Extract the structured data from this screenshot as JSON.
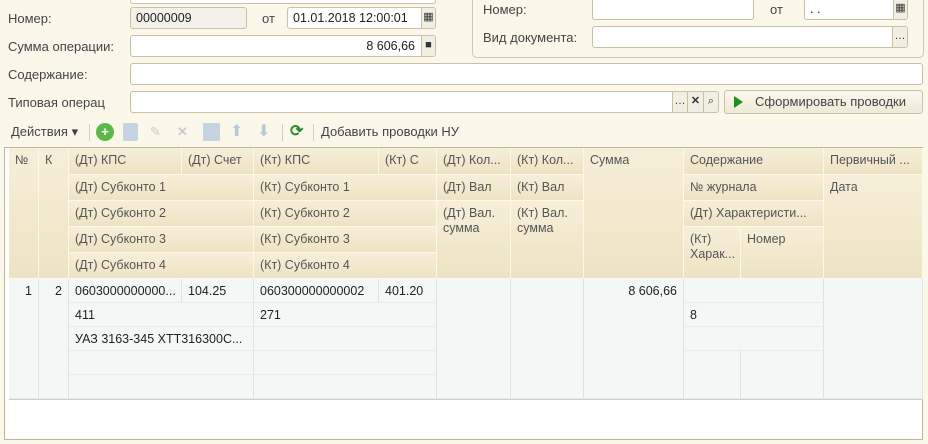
{
  "form": {
    "number_label": "Номер:",
    "number_value": "00000009",
    "from_label": "от",
    "date_value": "01.01.2018 12:00:01",
    "sum_label": "Сумма операции:",
    "sum_value": "8 606,66",
    "content_label": "Содержание:",
    "content_value": "",
    "typical_label": "Типовая операц",
    "typical_value": "",
    "generate_button": "Сформировать проводки"
  },
  "incoming": {
    "number_label": "Номер:",
    "number_value": "",
    "from_label": "от",
    "date_value": " .  . ",
    "doctype_label": "Вид документа:",
    "doctype_value": ""
  },
  "toolbar": {
    "actions": "Действия ▾",
    "add_nu": "Добавить проводки НУ"
  },
  "table": {
    "headers": {
      "n": "№",
      "k": "К",
      "dt_kps": "(Дт) КПС",
      "dt_acc": "(Дт) Счет",
      "kt_kps": "(Кт) КПС",
      "kt_acc": "(Кт) С",
      "dt_qty": "(Дт) Кол...",
      "kt_qty": "(Кт) Кол...",
      "sum": "Сумма",
      "content": "Содержание",
      "primary": "Первичный ...",
      "dt_sub1": "(Дт) Субконто 1",
      "kt_sub1": "(Кт) Субконто 1",
      "dt_cur": "(Дт) Вал",
      "kt_cur": "(Кт) Вал",
      "journal": "№ журнала",
      "date": "Дата",
      "dt_sub2": "(Дт) Субконто 2",
      "kt_sub2": "(Кт) Субконто 2",
      "dt_cur_sum": "(Дт) Вал. сумма",
      "kt_cur_sum": "(Кт) Вал. сумма",
      "dt_char": "(Дт) Характеристи...",
      "dt_sub3": "(Дт) Субконто 3",
      "kt_sub3": "(Кт) Субконто 3",
      "kt_char": "(Кт) Харак...",
      "number": "Номер",
      "dt_sub4": "(Дт) Субконто 4",
      "kt_sub4": "(Кт) Субконто 4"
    },
    "rows": [
      {
        "n": "1",
        "k": "2",
        "dt_kps": "0603000000000...",
        "dt_acc": "104.25",
        "kt_kps": "060300000000002",
        "kt_acc": "401.20",
        "sum": "8 606,66",
        "dt_sub1": "411",
        "kt_sub1": "271",
        "journal": "8",
        "dt_sub2": "УАЗ 3163-345 ХТТ316300С..."
      }
    ]
  }
}
